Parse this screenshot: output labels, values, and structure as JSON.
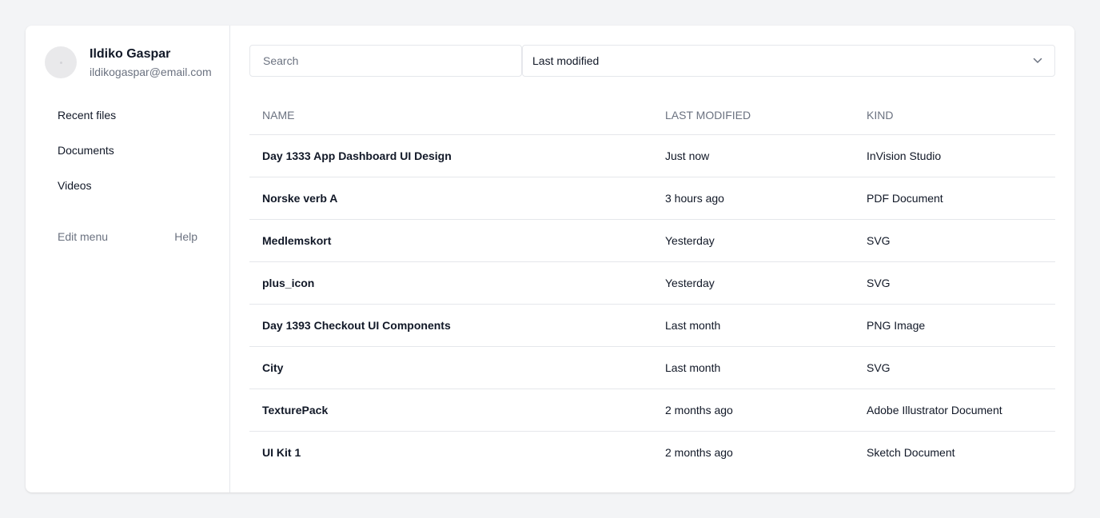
{
  "user": {
    "name": "Ildiko Gaspar",
    "email": "ildikogaspar@email.com"
  },
  "sidebar": {
    "items": [
      {
        "label": "Recent files"
      },
      {
        "label": "Documents"
      },
      {
        "label": "Videos"
      }
    ],
    "edit_menu": "Edit menu",
    "help": "Help"
  },
  "toolbar": {
    "search_placeholder": "Search",
    "sort_value": "Last modified"
  },
  "table": {
    "headers": [
      "Name",
      "Last modified",
      "Kind"
    ],
    "rows": [
      {
        "name": "Day 1333 App Dashboard UI Design",
        "modified": "Just now",
        "kind": "InVision Studio"
      },
      {
        "name": "Norske verb A",
        "modified": "3 hours ago",
        "kind": "PDF Document"
      },
      {
        "name": "Medlemskort",
        "modified": "Yesterday",
        "kind": "SVG"
      },
      {
        "name": "plus_icon",
        "modified": "Yesterday",
        "kind": "SVG"
      },
      {
        "name": "Day 1393 Checkout UI Components",
        "modified": "Last month",
        "kind": "PNG Image"
      },
      {
        "name": "City",
        "modified": "Last month",
        "kind": "SVG"
      },
      {
        "name": "TexturePack",
        "modified": "2 months ago",
        "kind": "Adobe Illustrator Document"
      },
      {
        "name": "UI Kit 1",
        "modified": "2 months ago",
        "kind": "Sketch Document"
      }
    ]
  },
  "colors": {
    "background": "#f3f4f6",
    "card": "#ffffff",
    "text_primary": "#111827",
    "text_muted": "#6b7280",
    "border": "#e5e7eb"
  },
  "icons": {
    "sort_dropdown": "chevron-down-icon"
  }
}
